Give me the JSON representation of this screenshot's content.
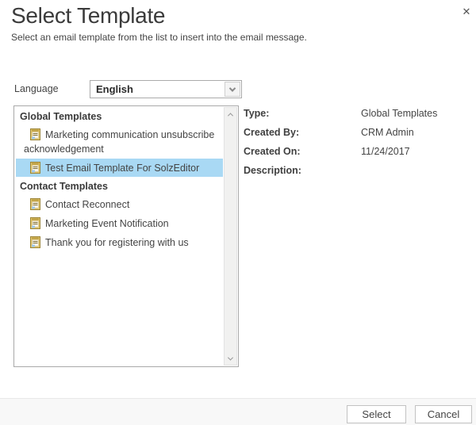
{
  "dialog": {
    "title": "Select Template",
    "subtitle": "Select an email template from the list to insert into the email message."
  },
  "icons": {
    "close": "✕",
    "template_item": "email-template-icon",
    "dropdown": "chevron-down-icon",
    "scroll_up": "chevron-up-icon",
    "scroll_down": "chevron-down-icon"
  },
  "language": {
    "label": "Language",
    "selected_option": "English"
  },
  "template_list": {
    "groups": [
      {
        "header": "Global Templates",
        "items": [
          {
            "label": "Marketing communication unsubscribe acknowledgement",
            "selected": false
          },
          {
            "label": "Test Email Template For SolzEditor",
            "selected": true
          }
        ]
      },
      {
        "header": "Contact Templates",
        "items": [
          {
            "label": "Contact Reconnect",
            "selected": false
          },
          {
            "label": "Marketing Event Notification",
            "selected": false
          },
          {
            "label": "Thank you for registering with us",
            "selected": false
          }
        ]
      }
    ]
  },
  "details": {
    "type_label": "Type:",
    "type_value": "Global Templates",
    "created_by_label": "Created By:",
    "created_by_value": "CRM Admin",
    "created_on_label": "Created On:",
    "created_on_value": "11/24/2017",
    "description_label": "Description:",
    "description_value": ""
  },
  "footer": {
    "select_label": "Select",
    "cancel_label": "Cancel"
  },
  "colors": {
    "selection_bg": "#A9D9F4",
    "title_text": "#3B3B3B",
    "body_text": "#444444",
    "footer_bg": "#F8F8F8"
  }
}
